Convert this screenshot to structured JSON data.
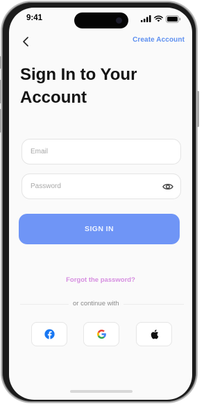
{
  "status_bar": {
    "time": "9:41"
  },
  "header": {
    "back_icon": "chevron-left-icon",
    "create_account_label": "Create Account"
  },
  "title": {
    "line1": "Sign In to Your",
    "line2": "Account"
  },
  "form": {
    "email": {
      "placeholder": "Email",
      "value": ""
    },
    "password": {
      "placeholder": "Password",
      "value": "",
      "toggle_icon": "eye-icon"
    },
    "signin_label": "SIGN IN"
  },
  "forgot_password_label": "Forgot the password?",
  "continue_with_label": "or continue with",
  "social": [
    {
      "name": "facebook",
      "icon": "facebook-icon"
    },
    {
      "name": "google",
      "icon": "google-icon"
    },
    {
      "name": "apple",
      "icon": "apple-icon"
    }
  ],
  "colors": {
    "accent": "#5d8ff0",
    "button": "#6f95f6",
    "forgot": "#d68ee0",
    "facebook": "#1877f2"
  }
}
